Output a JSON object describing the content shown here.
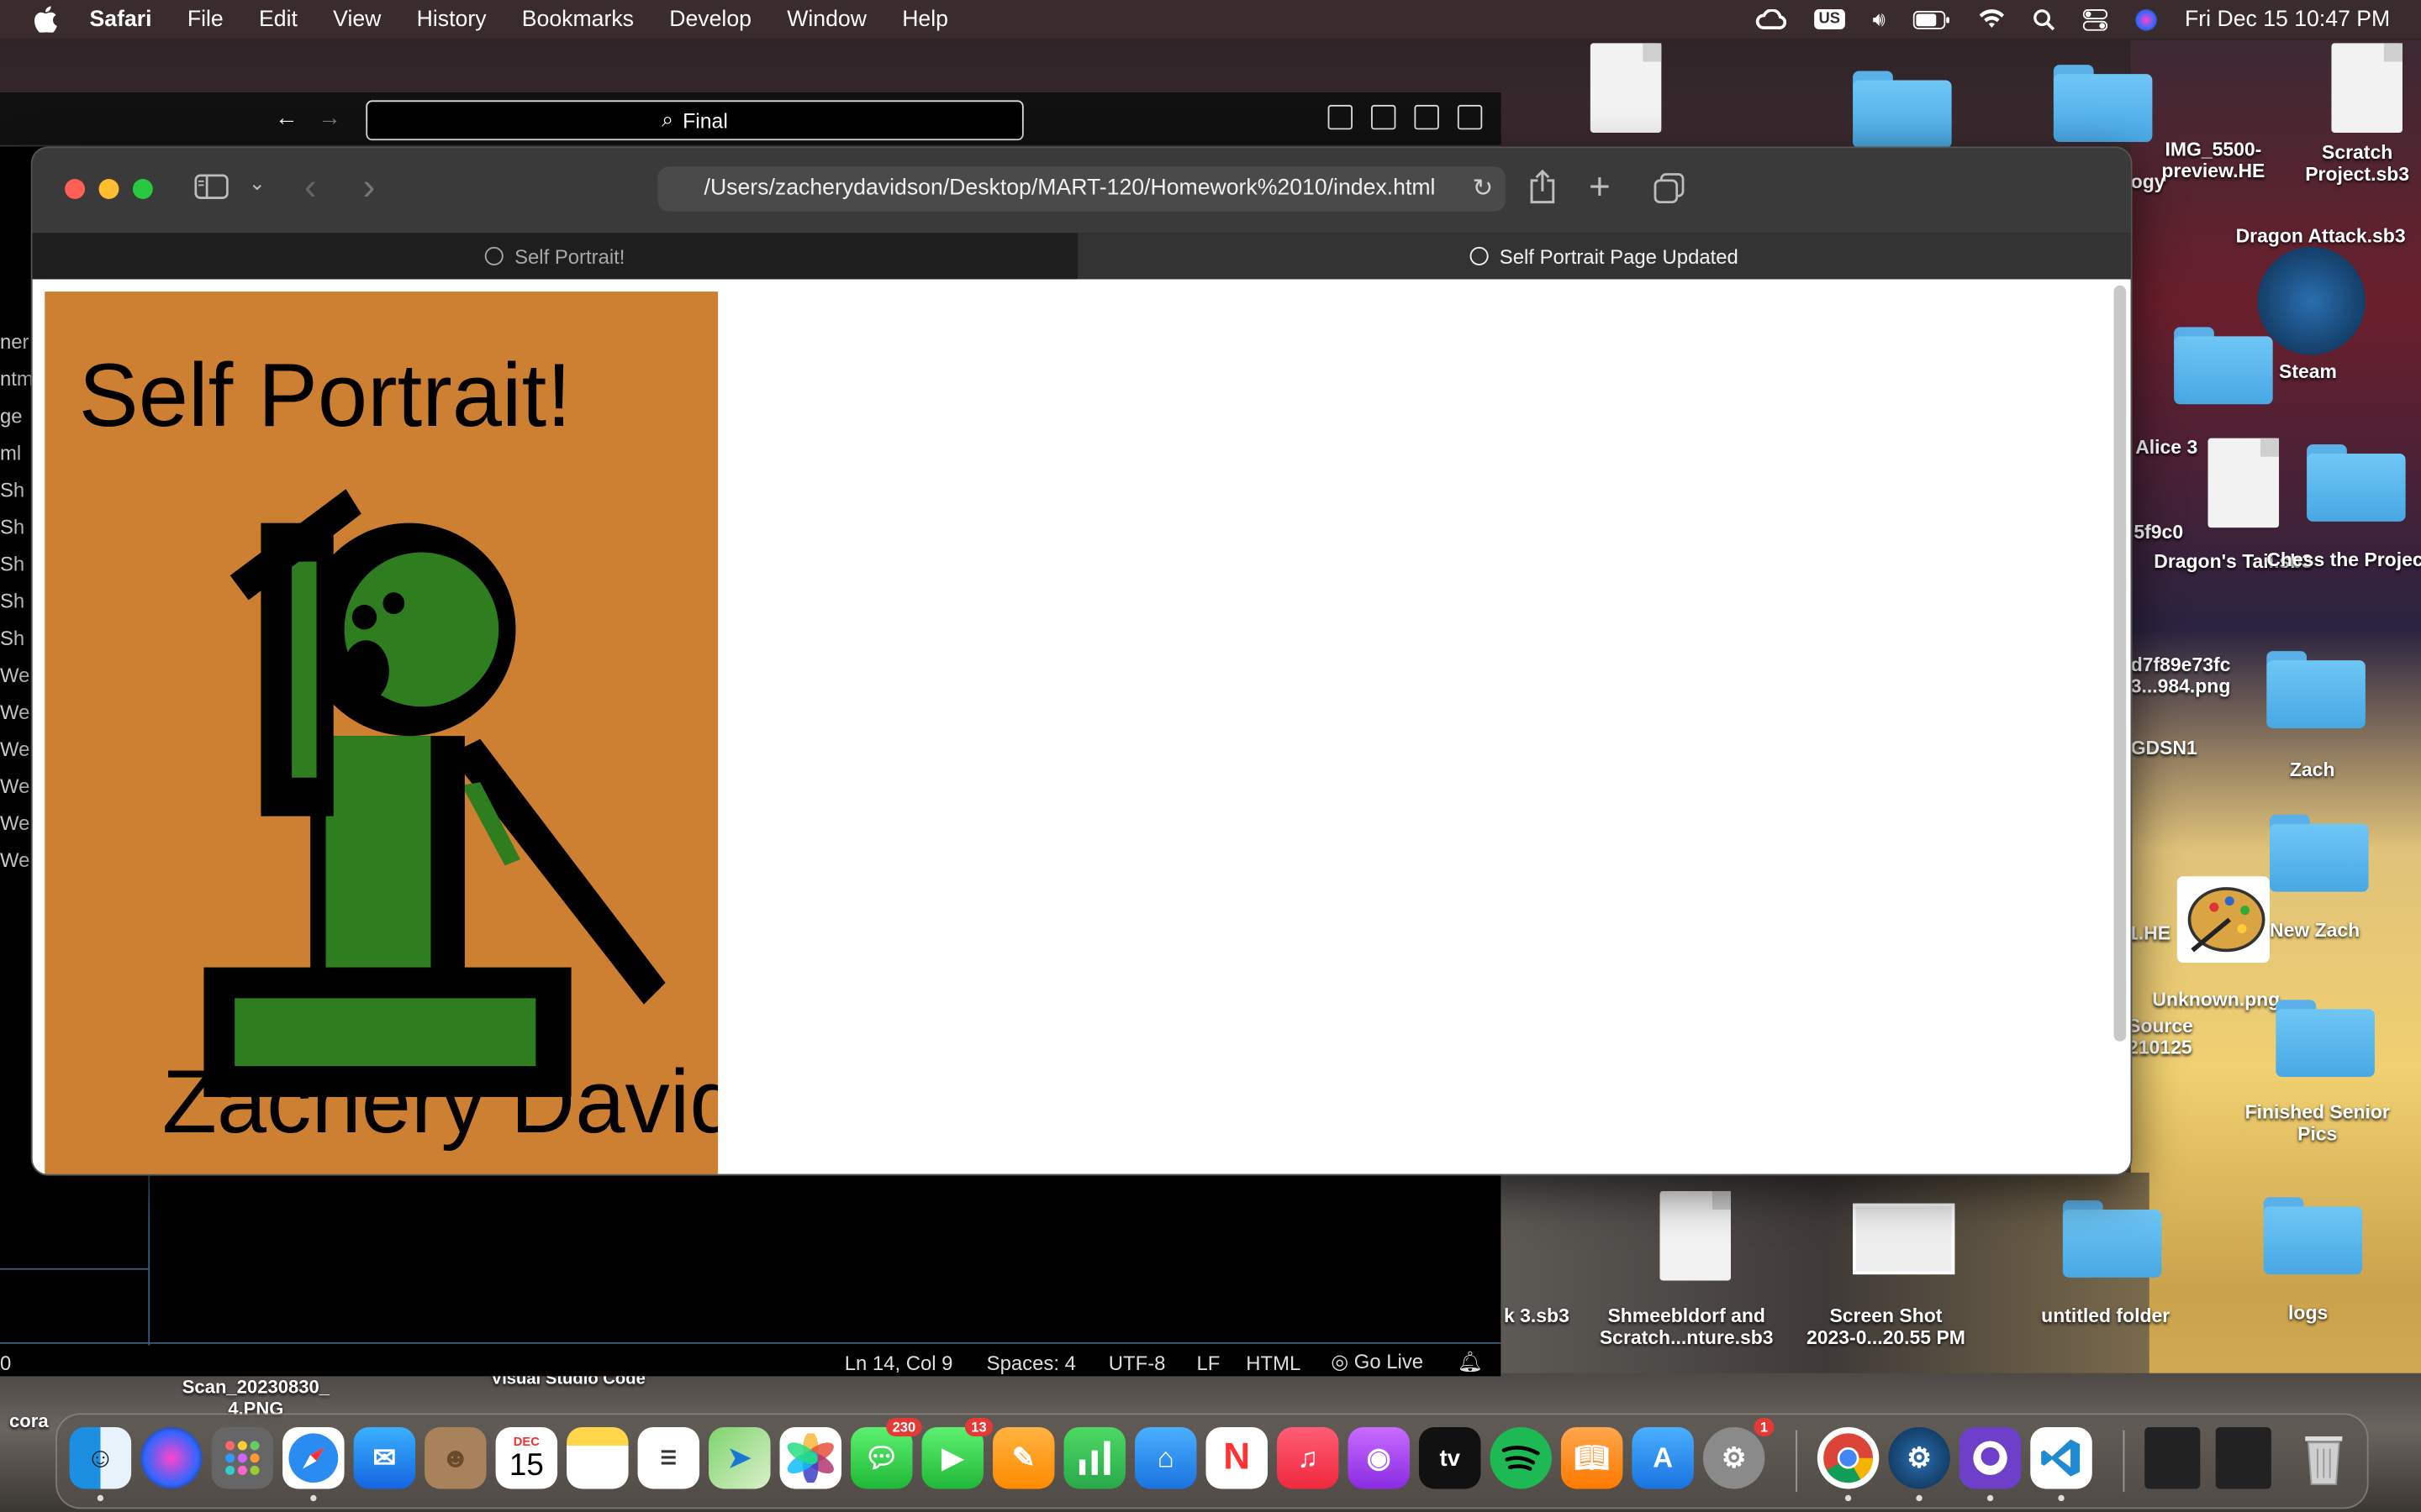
{
  "menubar": {
    "app": "Safari",
    "items": [
      "File",
      "Edit",
      "View",
      "History",
      "Bookmarks",
      "Develop",
      "Window",
      "Help"
    ],
    "input_source": "US",
    "clock": "Fri Dec 15  10:47 PM"
  },
  "vscode": {
    "search": "Final",
    "sidebar_fragments": [
      "ner",
      "ntm",
      "ge",
      "ml",
      "Sh",
      "Sh",
      "Sh",
      "Sh",
      "Sh",
      "We",
      "We",
      "We",
      "We",
      "We",
      "We"
    ],
    "status": {
      "left": "0",
      "position": "Ln 14, Col 9",
      "spaces": "Spaces: 4",
      "encoding": "UTF-8",
      "eol": "LF",
      "language": "HTML",
      "golive": "Go Live"
    }
  },
  "safari": {
    "url": "/Users/zacherydavidson/Desktop/MART-120/Homework%2010/index.html",
    "tabs": [
      {
        "label": "Self Portrait!",
        "active": false
      },
      {
        "label": "Self Portrait Page Updated",
        "active": true
      }
    ],
    "page": {
      "title": "Self Portrait!",
      "name": "Zachery Davids",
      "background": "#cd7f32",
      "figure_color": "#2e7d1e"
    }
  },
  "desktop": {
    "items": [
      {
        "label": "IMG_5500-\npreview.HE"
      },
      {
        "label": "Scratch\nProject.sb3"
      },
      {
        "label": "ogy"
      },
      {
        "label": "Dragon Attack.sb3"
      },
      {
        "label": "Steam"
      },
      {
        "label": "Alice 3"
      },
      {
        "label": "5f9c0"
      },
      {
        "label": "Dragon's Tail.sb3"
      },
      {
        "label": "Chess the Project"
      },
      {
        "label": "d7f89e73fc\n3...984.png"
      },
      {
        "label": "GDSN1"
      },
      {
        "label": "Zach"
      },
      {
        "label": "1.HE"
      },
      {
        "label": "New Zach"
      },
      {
        "label": "Unknown.png"
      },
      {
        "label": "Source\n210125"
      },
      {
        "label": "Finished Senior\nPics"
      },
      {
        "label": "k 3.sb3"
      },
      {
        "label": "Shmeebldorf and\nScratch...nture.sb3"
      },
      {
        "label": "Screen Shot\n2023-0...20.55 PM"
      },
      {
        "label": "untitled folder"
      },
      {
        "label": "logs"
      },
      {
        "label": "Scan_20230830_\n4.PNG"
      },
      {
        "label": "Visual Studio Code"
      },
      {
        "label": "cora"
      }
    ]
  },
  "dock": {
    "calendar_month": "DEC",
    "calendar_day": "15",
    "messages_badge": "230",
    "facetime_badge": "13",
    "settings_badge": "1",
    "appletv_label": "tv"
  }
}
